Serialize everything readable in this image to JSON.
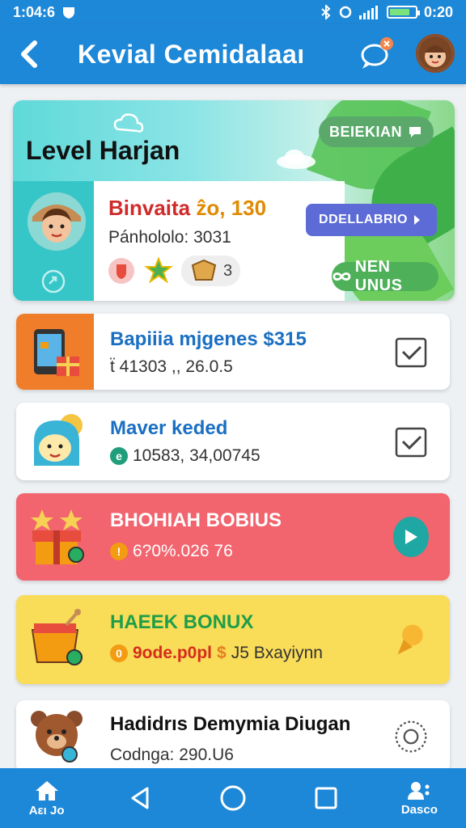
{
  "status_bar": {
    "time_left": "1:04:6",
    "time_right": "0:20"
  },
  "app_bar": {
    "back_icon": "back-arrow-icon",
    "title": "Kevial Cemidalaaı",
    "chat_icon": "chat-bubble-icon"
  },
  "level_card": {
    "title": "Level Harjan",
    "name": "Binvaita",
    "name_number": "ẑo, 130",
    "subtitle": "Pánhololo: 3031",
    "badge_count": "3",
    "btn_top": "BEIEKIAN",
    "btn_mid": "DDELLABRIO",
    "btn_bottom": "NEN UNUS"
  },
  "rows": [
    {
      "title": "Bapiiia mjgenes $315",
      "sub": "ẗ 41303 ,, 26.0.5"
    },
    {
      "title": "Maver keded",
      "sub": "10583, 34,00745"
    },
    {
      "title": "BHOHIAH BOBIUS",
      "sub": "6?0%.026 76"
    },
    {
      "title": "HAEEK BONUX",
      "sub_a": "9ode.p0pl",
      "sub_b": "$",
      "sub_c": "J5 Bxayiynn"
    },
    {
      "title": "Hadidrıs Demymia Diugan",
      "sub": "Codnga: 290.U6"
    }
  ],
  "bottom_nav": {
    "home_label": "Aει Jo",
    "profile_label": "Dasco"
  },
  "colors": {
    "primary": "#1e88d8",
    "red_row": "#f2646e",
    "yellow_row": "#f9dc57"
  }
}
